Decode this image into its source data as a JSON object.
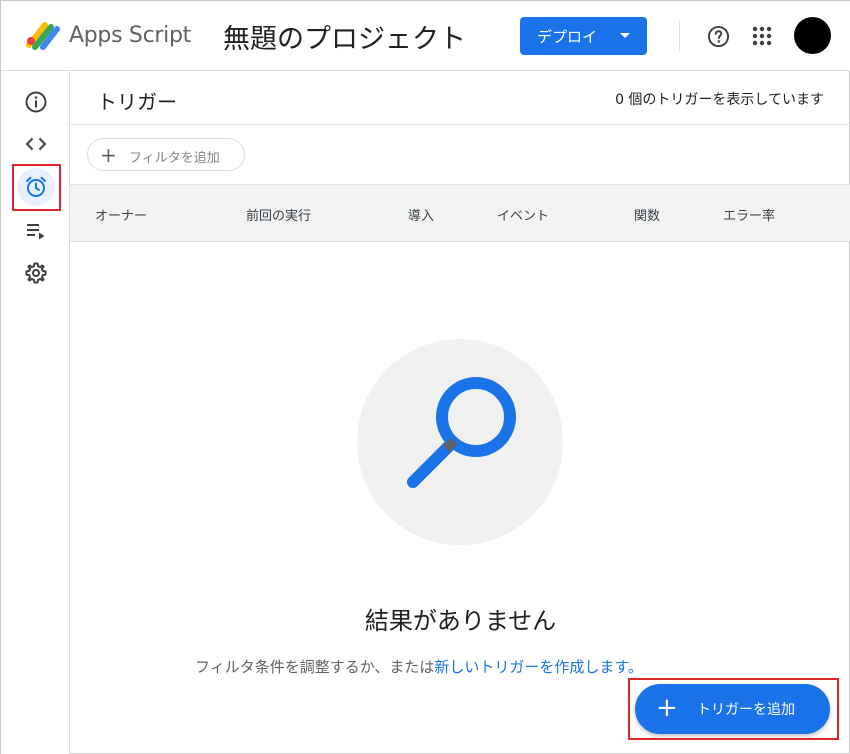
{
  "header": {
    "app_name": "Apps Script",
    "project_title": "無題のプロジェクト",
    "deploy_label": "デプロイ"
  },
  "rail": {
    "items": [
      {
        "icon": "info-icon"
      },
      {
        "icon": "code-icon"
      },
      {
        "icon": "alarm-clock-icon",
        "active": true
      },
      {
        "icon": "executions-icon"
      },
      {
        "icon": "gear-icon"
      }
    ]
  },
  "main": {
    "title": "トリガー",
    "count_text": "0 個のトリガーを表示しています",
    "filter_label": "フィルタを追加",
    "columns": [
      "オーナー",
      "前回の実行",
      "導入",
      "イベント",
      "関数",
      "エラー率"
    ],
    "empty_title": "結果がありません",
    "empty_sub_prefix": "フィルタ条件を調整するか、または",
    "empty_sub_link": "新しいトリガーを作成します。",
    "fab_label": "トリガーを追加"
  },
  "colors": {
    "accent": "#1a73e8",
    "highlight": "#e0262a",
    "active_bg": "#e8f0fe"
  }
}
